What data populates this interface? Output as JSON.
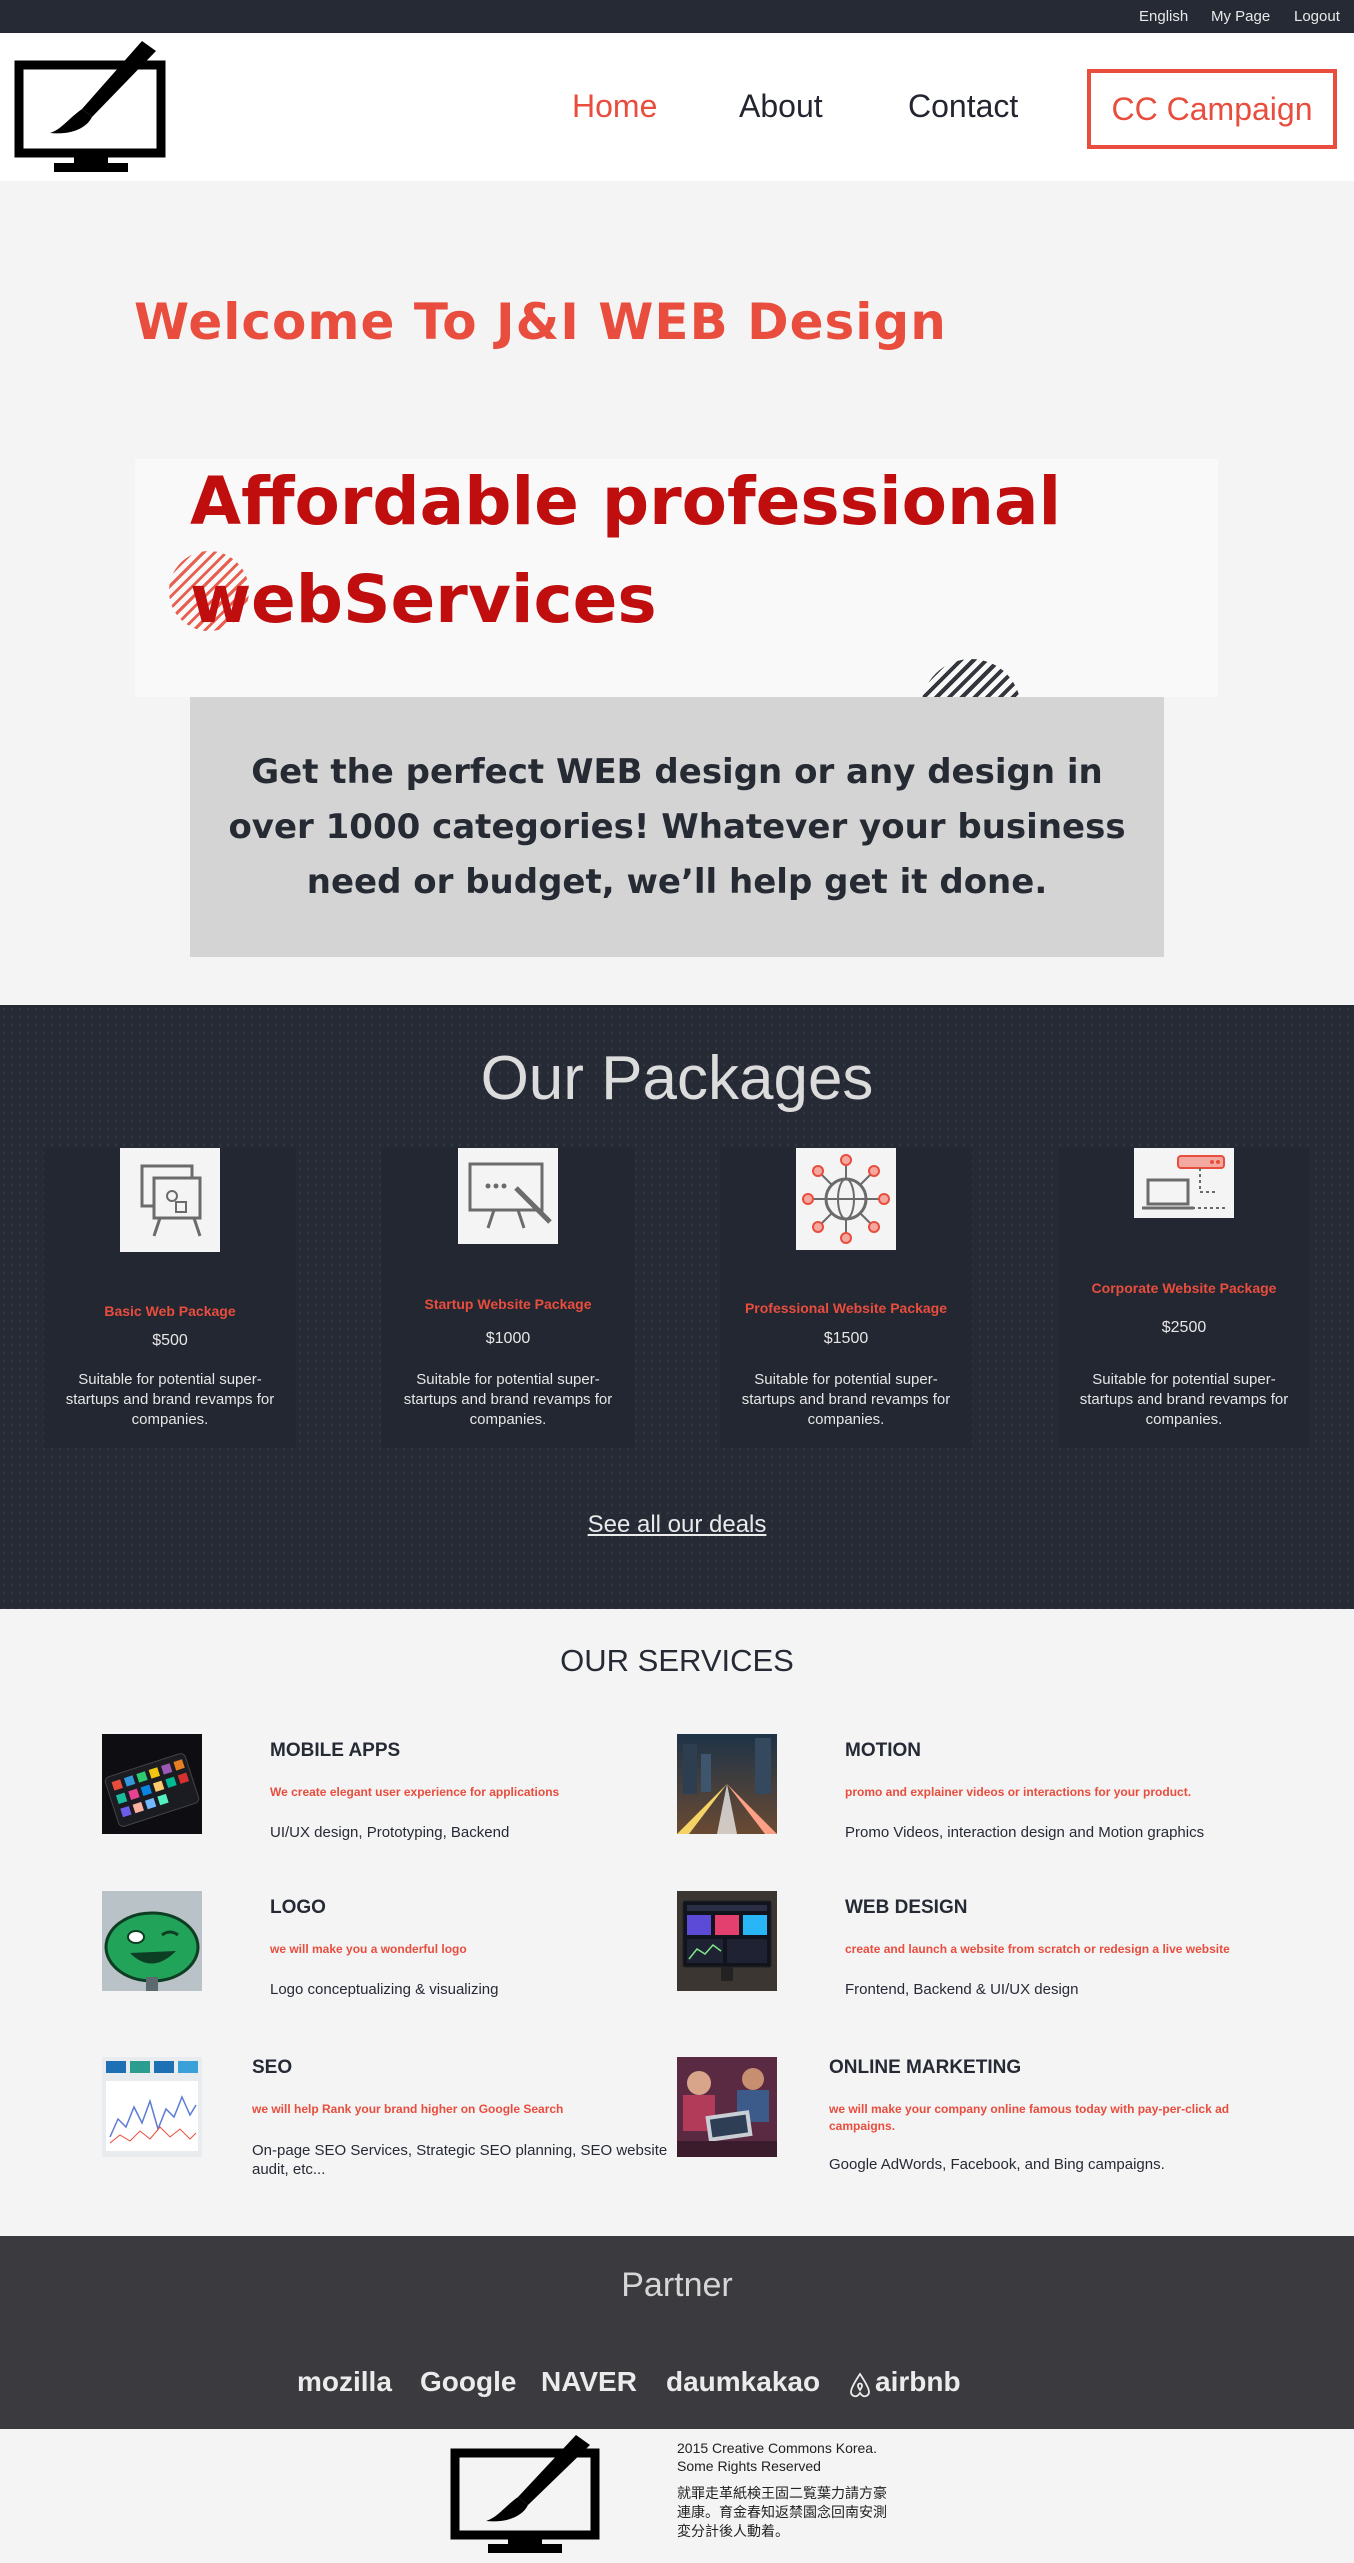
{
  "topbar": {
    "links": [
      "English",
      "My Page",
      "Logout"
    ]
  },
  "header": {
    "logo_icon": "monitor-with-brush-icon",
    "nav": [
      "Home",
      "About",
      "Contact"
    ],
    "active_nav": "Home",
    "cta_label": "CC Campaign"
  },
  "hero": {
    "welcome": "Welcome To J&I WEB Design",
    "headline_line1": "Affordable professional",
    "headline_line2": "webServices",
    "tagline": "Get the perfect WEB design or any design in over 1000 categories! Whatever your business need or budget, we’ll help get it done."
  },
  "packages": {
    "title": "Our Packages",
    "items": [
      {
        "name": "Basic Web Package",
        "price": "$500",
        "desc": "Suitable for potential super-startups and brand revamps for companies.",
        "icon": "presentation-board-icon"
      },
      {
        "name": "Startup Website Package",
        "price": "$1000",
        "desc": "Suitable for potential super-startups and brand revamps for companies.",
        "icon": "whiteboard-pen-icon"
      },
      {
        "name": "Professional Website Package",
        "price": "$1500",
        "desc": "Suitable for potential super-startups and brand revamps for companies.",
        "icon": "globe-network-icon"
      },
      {
        "name": "Corporate Website Package",
        "price": "$2500",
        "desc": "Suitable for potential super-startups and brand revamps for companies.",
        "icon": "laptop-server-icon"
      }
    ],
    "see_all": "See all our deals"
  },
  "services": {
    "title": "OUR SERVICES",
    "items": [
      {
        "title": "MOBILE APPS",
        "sub": "We create elegant user experience for applications",
        "desc": "UI/UX design, Prototyping, Backend",
        "thumb": "phone-apps-photo"
      },
      {
        "title": "MOTION",
        "sub": "promo and explainer videos or interactions for your product.",
        "desc": "Promo Videos, interaction design and Motion graphics",
        "thumb": "city-motion-photo"
      },
      {
        "title": "LOGO",
        "sub": "we will make you a wonderful logo",
        "desc": "Logo conceptualizing & visualizing",
        "thumb": "green-face-logo-photo"
      },
      {
        "title": "WEB DESIGN",
        "sub": "create and launch a website from scratch or redesign a live website",
        "desc": "Frontend, Backend & UI/UX design",
        "thumb": "monitor-dashboard-photo"
      },
      {
        "title": "SEO",
        "sub": "we will help Rank your brand higher on Google Search",
        "desc": "On-page SEO Services, Strategic SEO planning, SEO website audit, etc...",
        "thumb": "analytics-paper-photo"
      },
      {
        "title": "ONLINE MARKETING",
        "sub": "we will make your company online famous today with pay-per-click ad campaigns.",
        "desc": "Google AdWords, Facebook, and Bing campaigns.",
        "thumb": "team-laptop-photo"
      }
    ]
  },
  "partner": {
    "title": "Partner",
    "logos": [
      "mozilla",
      "Google",
      "NAVER",
      "daumkakao",
      "airbnb"
    ]
  },
  "footer": {
    "line1": "2015 Creative Commons Korea.",
    "line2": "Some Rights Reserved",
    "cjk1": "就罪走革紙検王固二覧葉力請方豪",
    "cjk2": "連康。育金春知返禁園念回南安測",
    "cjk3": "変分計後人動着。"
  },
  "colors": {
    "accent": "#e84d3d",
    "headline_red": "#c00e0e",
    "dark_navy": "#252a35",
    "partner_bg": "#3a3a3f"
  }
}
